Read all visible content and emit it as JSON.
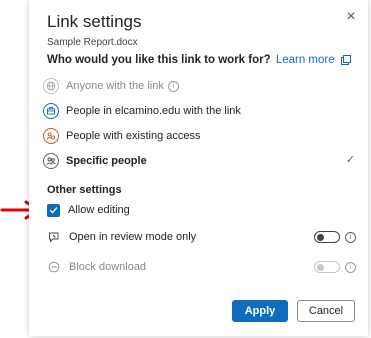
{
  "dialog": {
    "title": "Link settings",
    "filename": "Sample Report.docx",
    "question": "Who would you like this link to work for?",
    "learn_more": "Learn more",
    "options": [
      {
        "label": "Anyone with the link",
        "state": "disabled",
        "icon": "globe-icon"
      },
      {
        "label": "People in elcamino.edu with the link",
        "state": "enabled",
        "icon": "building-icon"
      },
      {
        "label": "People with existing access",
        "state": "enabled",
        "icon": "people-existing-icon"
      },
      {
        "label": "Specific people",
        "state": "selected",
        "icon": "people-icon"
      }
    ],
    "other_settings": {
      "heading": "Other settings",
      "allow_editing": {
        "label": "Allow editing",
        "checked": true
      },
      "review_mode": {
        "label": "Open in review mode only",
        "enabled": false
      },
      "block_download": {
        "label": "Block download",
        "enabled": false,
        "disabled": true
      }
    },
    "apply_label": "Apply",
    "cancel_label": "Cancel",
    "close_label": "×"
  },
  "colors": {
    "accent": "#0f6cbd",
    "annotation_arrow": "#e00000"
  }
}
